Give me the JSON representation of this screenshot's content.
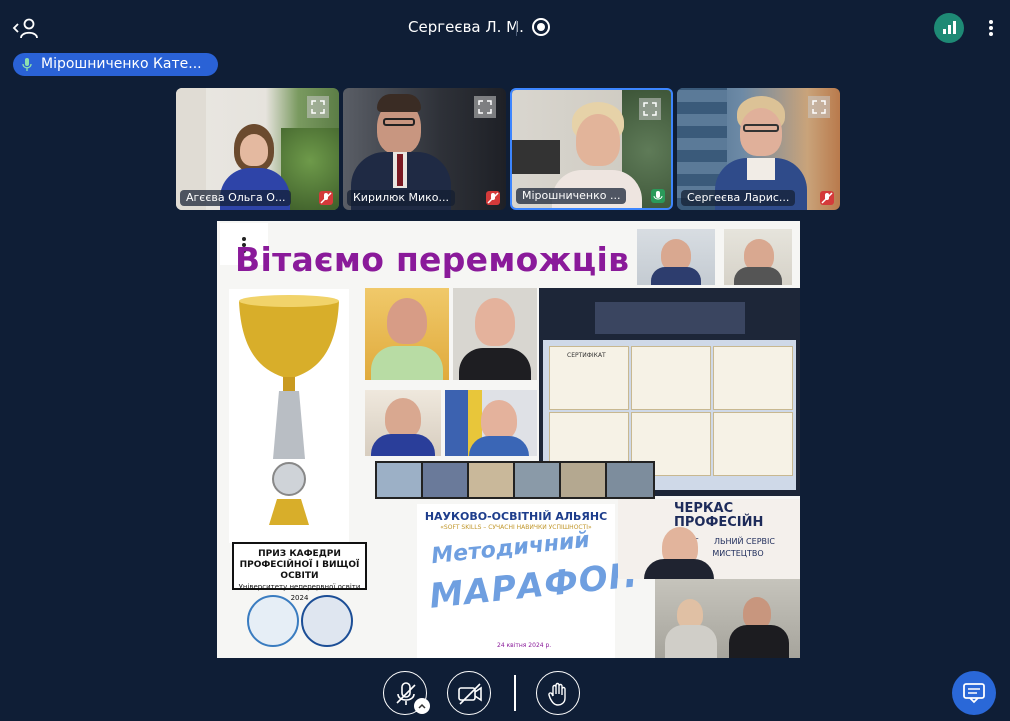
{
  "header": {
    "host_name": "Сергеєва Л. М."
  },
  "active_speaker": {
    "name": "Мірошниченко Кате..."
  },
  "participants": [
    {
      "name": "Агєєва Ольга О...",
      "muted": true
    },
    {
      "name": "Кирилюк Мико...",
      "muted": true
    },
    {
      "name": "Мірошниченко ...",
      "muted": false
    },
    {
      "name": "Сергеєва Ларис...",
      "muted": true
    }
  ],
  "shared_slide": {
    "title": "Вітаємо переможців",
    "cup_label_line1": "ПРИЗ КАФЕДРИ",
    "cup_label_line2": "ПРОФЕСІЙНОЇ І ВИЩОЇ ОСВІТИ",
    "cup_label_line3": "Університету неперервної освіти 2024",
    "alliance_line1": "НАУКОВО-ОСВІТНІЙ АЛЬЯНС",
    "alliance_line2": "«SOFT SKILLS – СУЧАСНІ НАВИЧКИ УСПІШНОСТІ»",
    "marathon_line1": "Методичний",
    "marathon_line2": "МАРАФОН",
    "marathon_date": "24 квітня 2024 р.",
    "cherkasy_line1": "ЧЕРКАС",
    "cherkasy_line2": "ПРОФЕСІЙН",
    "cherkasy_line3": "РЕГ      ЛЬНИЙ СЕРВІС",
    "cherkasy_line4": "КУ       МИСТЕЦТВО",
    "certificate_label": "СЕРТИФІКАТ"
  },
  "colors": {
    "background": "#0f1e36",
    "accent": "#2a68d8",
    "signal": "#1e8a75",
    "title": "#8a1a9a"
  }
}
